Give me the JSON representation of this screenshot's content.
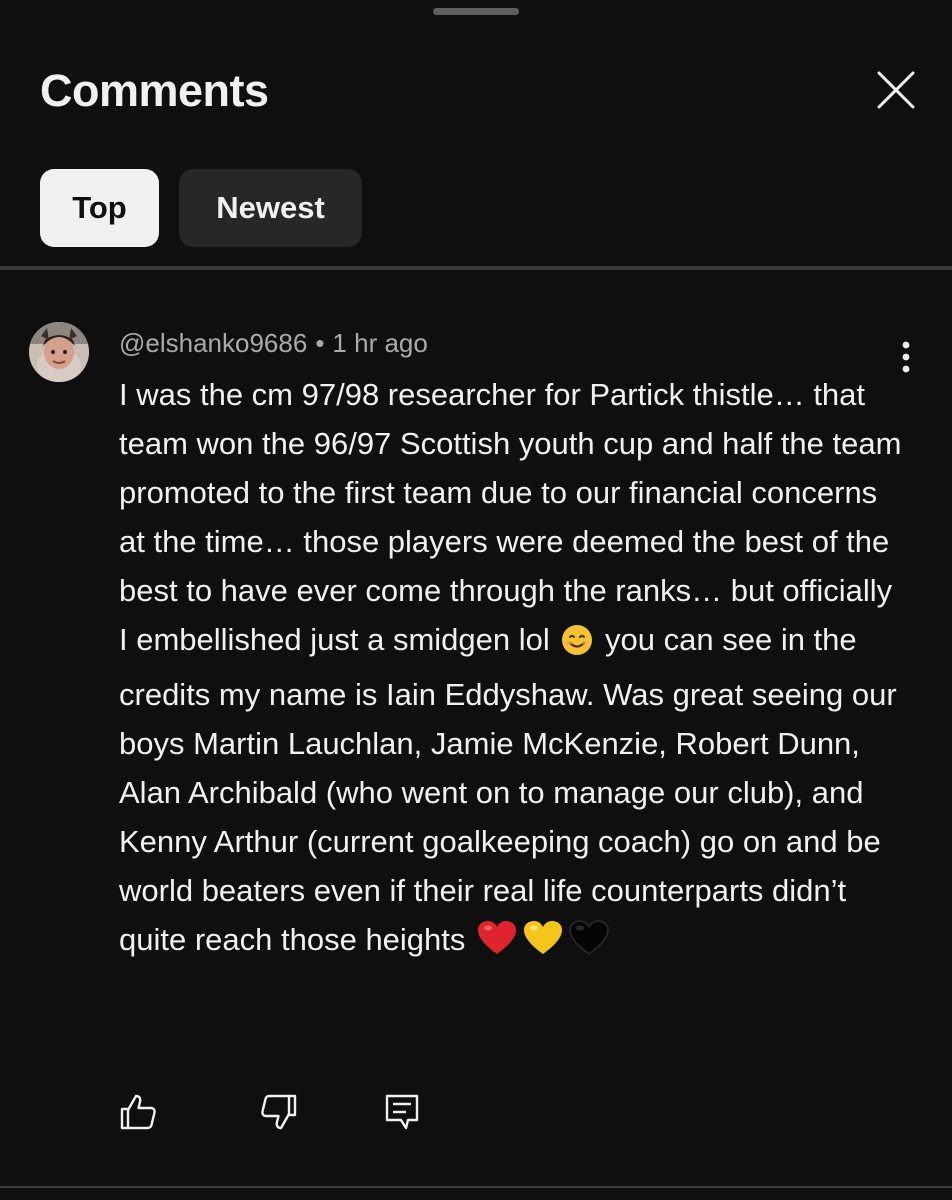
{
  "sheet": {
    "title": "Comments",
    "close_icon": "close-icon",
    "handle_icon": "drag-handle"
  },
  "sort_chips": [
    {
      "label": "Top",
      "selected": true
    },
    {
      "label": "Newest",
      "selected": false
    }
  ],
  "comment": {
    "author": "@elshanko9686",
    "separator": "•",
    "time": "1 hr ago",
    "text_part1": "I was the cm 97/98 researcher for Partick thistle… that team won the 96/97 Scottish youth cup and half the team promoted to the first team due to our financial concerns at the time… those players were deemed the best of the best to have ever come through the ranks… but officially I embellished just a smidgen lol",
    "emoji_smile": "smiling-face-emoji",
    "text_part2": "you can see in the credits my name is Iain Eddyshaw. Was great seeing our boys Martin Lauchlan, Jamie McKenzie, Robert Dunn, Alan Archibald (who went on to manage our club), and Kenny Arthur (current goalkeeping coach) go on and be world beaters even if their real life counterparts didn’t quite reach those heights",
    "emoji_hearts": [
      "red-heart-emoji",
      "yellow-heart-emoji",
      "black-heart-emoji"
    ],
    "more_icon": "more-vertical-icon"
  },
  "actions": [
    {
      "name": "like",
      "icon": "thumbs-up-icon"
    },
    {
      "name": "dislike",
      "icon": "thumbs-down-icon"
    },
    {
      "name": "reply",
      "icon": "reply-icon"
    }
  ],
  "colors": {
    "background": "#0f0f0f",
    "text_primary": "#f1f1f1",
    "text_secondary": "#aaaaaa",
    "chip_selected_bg": "#f1f1f1",
    "chip_bg": "#272727",
    "divider": "#3a3a3a",
    "heart_red": "#e0242e",
    "heart_yellow": "#f5c51c"
  }
}
